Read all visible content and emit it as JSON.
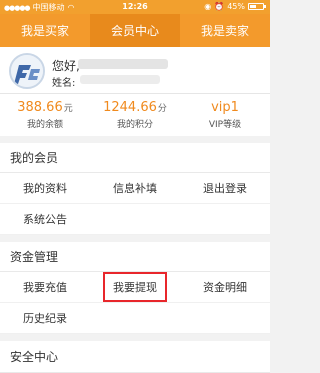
{
  "status_bar": {
    "carrier": "中国移动",
    "time": "12:26",
    "battery": "45%"
  },
  "tabs": [
    {
      "label": "我是买家"
    },
    {
      "label": "会员中心"
    },
    {
      "label": "我是卖家"
    }
  ],
  "profile": {
    "greeting": "您好,",
    "name_label": "姓名:"
  },
  "stats": [
    {
      "value": "388.66",
      "unit": "元",
      "label": "我的余额"
    },
    {
      "value": "1244.66",
      "unit": "分",
      "label": "我的积分"
    },
    {
      "value": "vip1",
      "unit": "",
      "label": "VIP等级"
    }
  ],
  "member_section": {
    "title": "我的会员",
    "items": [
      "我的资料",
      "信息补填",
      "退出登录",
      "系统公告"
    ]
  },
  "fund_section": {
    "title": "资金管理",
    "items": [
      "我要充值",
      "我要提现",
      "资金明细",
      "历史纪录"
    ]
  },
  "security_section": {
    "title": "安全中心"
  },
  "colors": {
    "accent": "#f39a2c",
    "accent_dark": "#e88a1c",
    "value": "#f08a1e",
    "highlight_border": "#e8262b"
  }
}
